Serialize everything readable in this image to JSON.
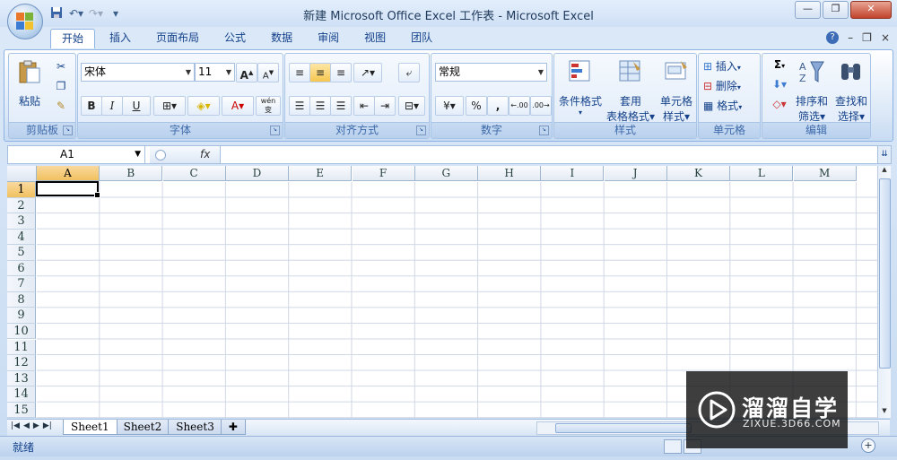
{
  "window": {
    "title": "新建 Microsoft Office Excel 工作表 - Microsoft Excel",
    "controls": {
      "minimize": "—",
      "restore": "❐",
      "close": "✕"
    }
  },
  "ribbon": {
    "tabs": [
      "开始",
      "插入",
      "页面布局",
      "公式",
      "数据",
      "审阅",
      "视图",
      "团队"
    ],
    "active_tab": "开始",
    "help_glyph": "?",
    "mini_min": "–",
    "mini_restore": "❐",
    "mini_close": "×",
    "groups": {
      "clipboard": {
        "label": "剪贴板",
        "paste": "粘贴"
      },
      "font": {
        "label": "字体",
        "font_name": "宋体",
        "font_size": "11",
        "bold": "B",
        "italic": "I",
        "underline": "U",
        "grow": "A",
        "shrink": "A",
        "color_a": "A",
        "phonetic": "wén"
      },
      "alignment": {
        "label": "对齐方式"
      },
      "number": {
        "label": "数字",
        "format": "常规",
        "percent": "%",
        "comma": ",",
        "inc_dec": ".00",
        "dec_dec": ".00"
      },
      "styles": {
        "label": "样式",
        "cond_format": "条件格式",
        "table_format_1": "套用",
        "table_format_2": "表格格式",
        "cell_style_1": "单元格",
        "cell_style_2": "样式"
      },
      "cells": {
        "label": "单元格",
        "insert": "插入",
        "delete": "删除",
        "format": "格式"
      },
      "editing": {
        "label": "编辑",
        "sort_1": "排序和",
        "sort_2": "筛选",
        "find_1": "查找和",
        "find_2": "选择",
        "sigma": "Σ"
      }
    }
  },
  "formula_bar": {
    "name_box": "A1",
    "fx": "fx",
    "value": ""
  },
  "grid": {
    "columns": [
      "A",
      "B",
      "C",
      "D",
      "E",
      "F",
      "G",
      "H",
      "I",
      "J",
      "K",
      "L",
      "M"
    ],
    "rows": [
      "1",
      "2",
      "3",
      "4",
      "5",
      "6",
      "7",
      "8",
      "9",
      "10",
      "11",
      "12",
      "13",
      "14",
      "15"
    ],
    "active_cell": "A1"
  },
  "sheets": {
    "tabs": [
      "Sheet1",
      "Sheet2",
      "Sheet3"
    ],
    "active": "Sheet1"
  },
  "status": {
    "text": "就绪"
  },
  "watermark": {
    "brand": "溜溜自学",
    "url": "ZIXUE.3D66.COM"
  },
  "colors": {
    "accent": "#15428b",
    "selected_header": "#f1c15f",
    "ribbon_bg": "#dbe8f7"
  }
}
